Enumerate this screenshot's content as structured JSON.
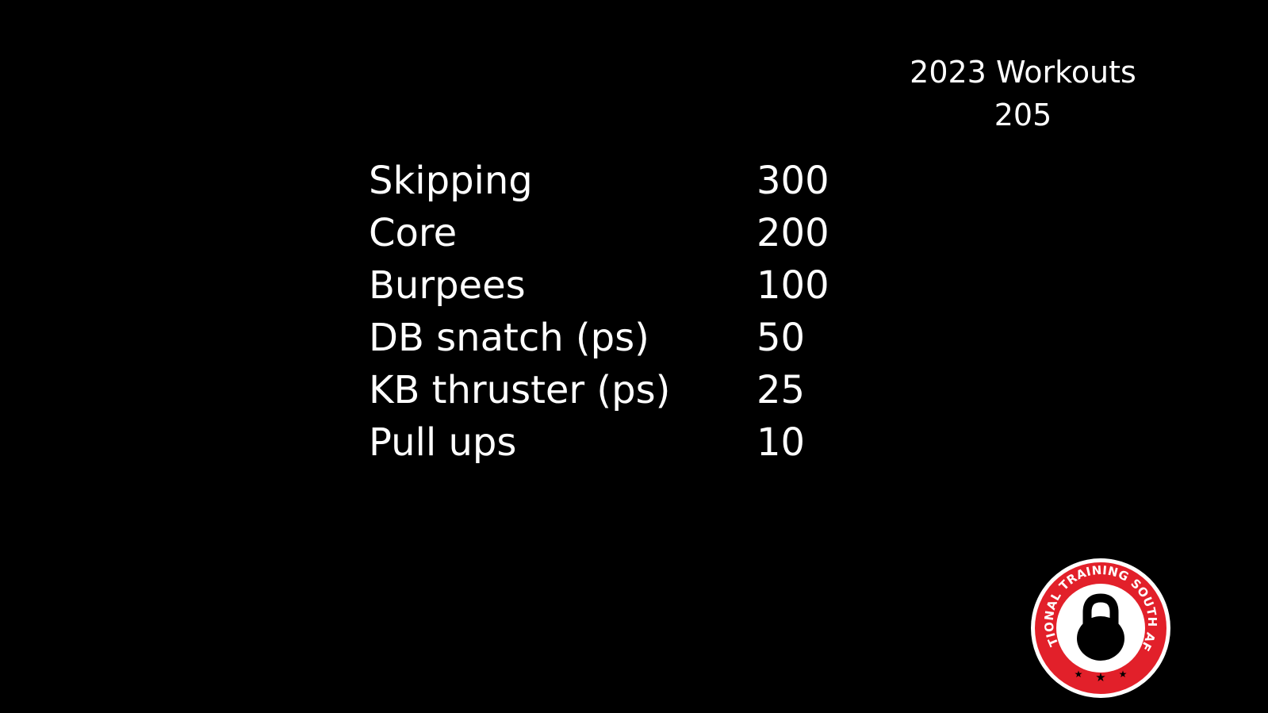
{
  "header": {
    "title": "2023 Workouts",
    "number": "205"
  },
  "workouts": [
    {
      "name": "Skipping",
      "reps": "300"
    },
    {
      "name": "Core",
      "reps": "200"
    },
    {
      "name": "Burpees",
      "reps": "100"
    },
    {
      "name": "DB snatch (ps)",
      "reps": "50"
    },
    {
      "name": "KB thruster (ps)",
      "reps": "25"
    },
    {
      "name": "Pull ups",
      "reps": "10"
    }
  ],
  "logo": {
    "text": "FUNCTIONAL TRAINING SOUTH AFRICA",
    "icon": "kettlebell-icon",
    "colors": {
      "ring": "#e2202a",
      "center": "#ffffff",
      "mark": "#000000"
    }
  }
}
